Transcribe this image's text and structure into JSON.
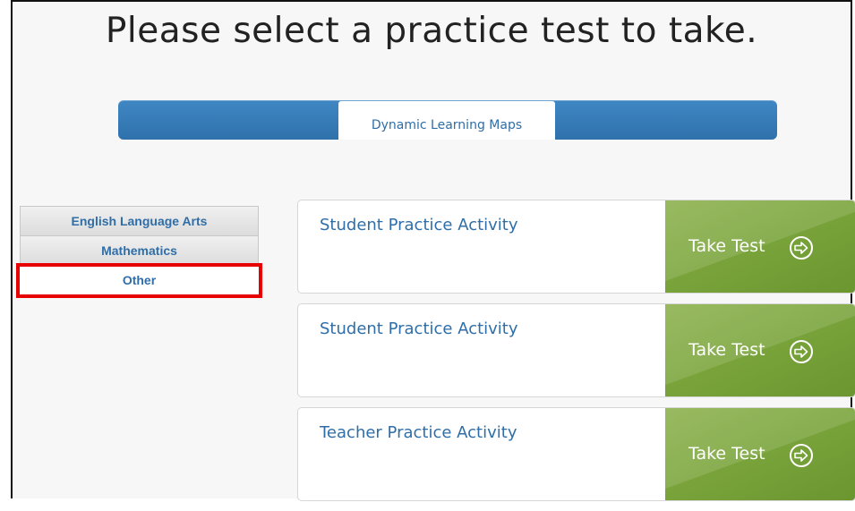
{
  "page": {
    "title": "Please select a practice test to take."
  },
  "program_bar": {
    "selected_tab": "Dynamic Learning Maps"
  },
  "subjects": {
    "items": [
      {
        "label": "English Language Arts",
        "selected": false
      },
      {
        "label": "Mathematics",
        "selected": false
      },
      {
        "label": "Other",
        "selected": true
      }
    ],
    "highlight_color": "#e60000"
  },
  "activities": {
    "items": [
      {
        "title": "Student Practice Activity",
        "action": "Take Test"
      },
      {
        "title": "Student Practice Activity",
        "action": "Take Test"
      },
      {
        "title": "Teacher Practice Activity",
        "action": "Take Test"
      }
    ],
    "action_icon": "arrow-right-circle-icon"
  },
  "colors": {
    "accent_blue": "#2f6ea8",
    "action_green": "#7aa43b"
  }
}
